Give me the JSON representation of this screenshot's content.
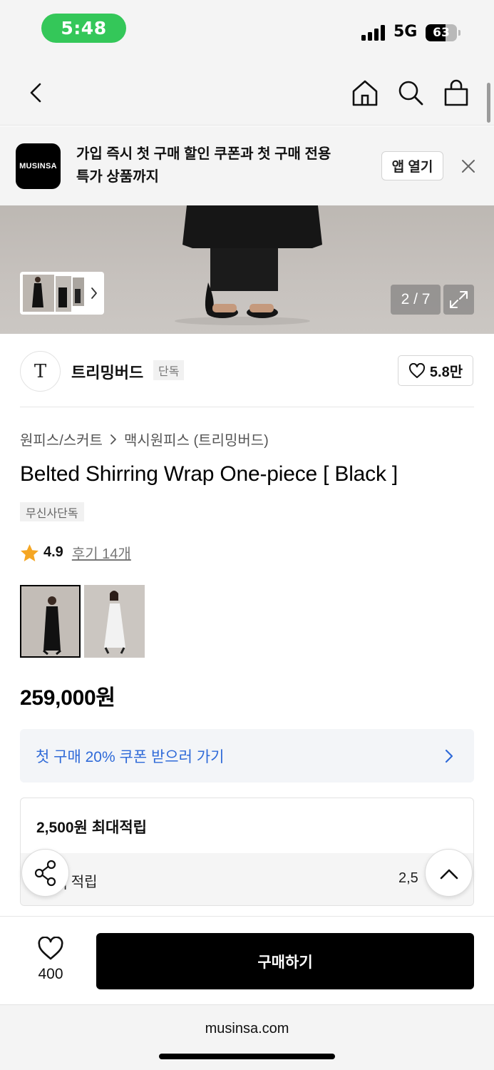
{
  "status_bar": {
    "time": "5:48",
    "network": "5G",
    "battery_percent": "63",
    "battery_level": 0.63
  },
  "nav": {
    "back_icon": "chevron-left-icon",
    "home_icon": "home-icon",
    "search_icon": "search-icon",
    "cart_icon": "shopping-bag-icon"
  },
  "app_banner": {
    "logo_text": "MUSINSA",
    "message_line1": "가입 즉시 첫 구매 할인 쿠폰과 첫 구매 전용",
    "message_line2": "특가 상품까지",
    "open_button": "앱 열기",
    "close_icon": "close-icon"
  },
  "gallery": {
    "counter": "2 / 7",
    "expand_icon": "expand-icon",
    "thumb_chevron_icon": "chevron-right-icon"
  },
  "brand": {
    "logo_letter": "T",
    "name": "트리밍버드",
    "tag": "단독",
    "likes": "5.8만",
    "heart_icon": "heart-icon"
  },
  "breadcrumb": {
    "category": "원피스/스커트",
    "subcategory": "맥시원피스 (트리밍버드)"
  },
  "product": {
    "title": "Belted Shirring Wrap One-piece [ Black ]",
    "tag": "무신사단독",
    "rating": "4.9",
    "reviews": "후기 14개",
    "price": "259,000원"
  },
  "colors": [
    {
      "name": "black-dress"
    },
    {
      "name": "white-dress"
    }
  ],
  "coupon": {
    "label": "첫 구매 20% 쿠폰 받으러 가기"
  },
  "points": {
    "title": "2,500원 최대적립",
    "sub_label": "| 적립",
    "sub_value": "2,5"
  },
  "action_bar": {
    "wish_count": "400",
    "buy_label": "구매하기"
  },
  "browser": {
    "url": "musinsa.com"
  },
  "colors_theme": {
    "accent_blue": "#2f6ad8",
    "status_green": "#34c759",
    "star": "#f5a623"
  }
}
